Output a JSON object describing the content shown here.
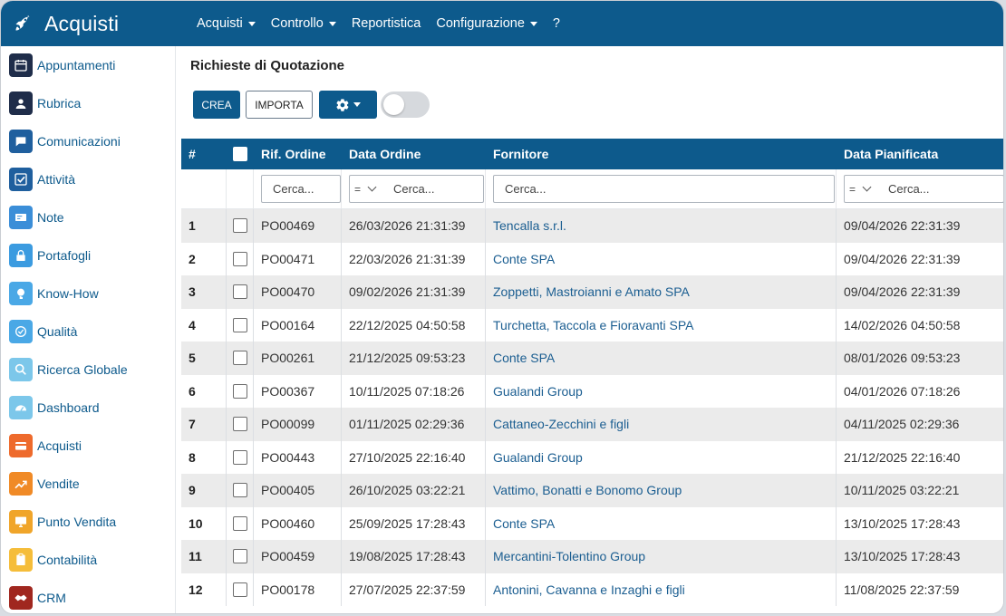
{
  "app": {
    "title": "Acquisti"
  },
  "menu": [
    {
      "label": "Acquisti",
      "dropdown": true
    },
    {
      "label": "Controllo",
      "dropdown": true
    },
    {
      "label": "Reportistica",
      "dropdown": false
    },
    {
      "label": "Configurazione",
      "dropdown": true
    },
    {
      "label": "?",
      "dropdown": false
    }
  ],
  "sidebar": {
    "items": [
      {
        "label": "Appuntamenti",
        "icon": "calendar-icon",
        "color": "#1f2d4a"
      },
      {
        "label": "Rubrica",
        "icon": "contacts-icon",
        "color": "#1f2d4a"
      },
      {
        "label": "Comunicazioni",
        "icon": "chat-icon",
        "color": "#1f5f9e"
      },
      {
        "label": "Attività",
        "icon": "checkbox-icon",
        "color": "#1f5f9e"
      },
      {
        "label": "Note",
        "icon": "note-icon",
        "color": "#3b8ed8"
      },
      {
        "label": "Portafogli",
        "icon": "lock-icon",
        "color": "#3b9be0"
      },
      {
        "label": "Know-How",
        "icon": "brain-icon",
        "color": "#4aa8e6"
      },
      {
        "label": "Qualità",
        "icon": "quality-icon",
        "color": "#4aa8e6"
      },
      {
        "label": "Ricerca Globale",
        "icon": "search-icon",
        "color": "#7cc7ea"
      },
      {
        "label": "Dashboard",
        "icon": "dashboard-icon",
        "color": "#7cc7ea"
      },
      {
        "label": "Acquisti",
        "icon": "card-icon",
        "color": "#ee6a2c"
      },
      {
        "label": "Vendite",
        "icon": "trend-icon",
        "color": "#f08a26"
      },
      {
        "label": "Punto Vendita",
        "icon": "monitor-icon",
        "color": "#f0a52a"
      },
      {
        "label": "Contabilità",
        "icon": "clipboard-icon",
        "color": "#f5bd3a"
      },
      {
        "label": "CRM",
        "icon": "handshake-icon",
        "color": "#a0271f"
      }
    ]
  },
  "page": {
    "title": "Richieste di Quotazione",
    "buttons": {
      "crea": "CREA",
      "importa": "IMPORTA"
    }
  },
  "table": {
    "headers": {
      "num": "#",
      "ref": "Rif. Ordine",
      "date": "Data Ordine",
      "supplier": "Fornitore",
      "planned": "Data Pianificata"
    },
    "filters": {
      "ref": "Cerca...",
      "date_op": "=",
      "date": "Cerca...",
      "supplier": "Cerca...",
      "planned_op": "=",
      "planned": "Cerca..."
    },
    "rows": [
      {
        "num": "1",
        "ref": "PO00469",
        "date": "26/03/2026 21:31:39",
        "supplier": "Tencalla s.r.l.",
        "planned": "09/04/2026 22:31:39"
      },
      {
        "num": "2",
        "ref": "PO00471",
        "date": "22/03/2026 21:31:39",
        "supplier": "Conte SPA",
        "planned": "09/04/2026 22:31:39"
      },
      {
        "num": "3",
        "ref": "PO00470",
        "date": "09/02/2026 21:31:39",
        "supplier": "Zoppetti, Mastroianni e Amato SPA",
        "planned": "09/04/2026 22:31:39"
      },
      {
        "num": "4",
        "ref": "PO00164",
        "date": "22/12/2025 04:50:58",
        "supplier": "Turchetta, Taccola e Fioravanti SPA",
        "planned": "14/02/2026 04:50:58"
      },
      {
        "num": "5",
        "ref": "PO00261",
        "date": "21/12/2025 09:53:23",
        "supplier": "Conte SPA",
        "planned": "08/01/2026 09:53:23"
      },
      {
        "num": "6",
        "ref": "PO00367",
        "date": "10/11/2025 07:18:26",
        "supplier": "Gualandi Group",
        "planned": "04/01/2026 07:18:26"
      },
      {
        "num": "7",
        "ref": "PO00099",
        "date": "01/11/2025 02:29:36",
        "supplier": "Cattaneo-Zecchini e figli",
        "planned": "04/11/2025 02:29:36"
      },
      {
        "num": "8",
        "ref": "PO00443",
        "date": "27/10/2025 22:16:40",
        "supplier": "Gualandi Group",
        "planned": "21/12/2025 22:16:40"
      },
      {
        "num": "9",
        "ref": "PO00405",
        "date": "26/10/2025 03:22:21",
        "supplier": "Vattimo, Bonatti e Bonomo Group",
        "planned": "10/11/2025 03:22:21"
      },
      {
        "num": "10",
        "ref": "PO00460",
        "date": "25/09/2025 17:28:43",
        "supplier": "Conte SPA",
        "planned": "13/10/2025 17:28:43"
      },
      {
        "num": "11",
        "ref": "PO00459",
        "date": "19/08/2025 17:28:43",
        "supplier": "Mercantini-Tolentino Group",
        "planned": "13/10/2025 17:28:43"
      },
      {
        "num": "12",
        "ref": "PO00178",
        "date": "27/07/2025 22:37:59",
        "supplier": "Antonini, Cavanna e Inzaghi e figli",
        "planned": "11/08/2025 22:37:59"
      }
    ]
  },
  "colors": {
    "primary": "#0d5a8c",
    "link": "#1b5e91",
    "row_alt": "#ebebeb"
  }
}
